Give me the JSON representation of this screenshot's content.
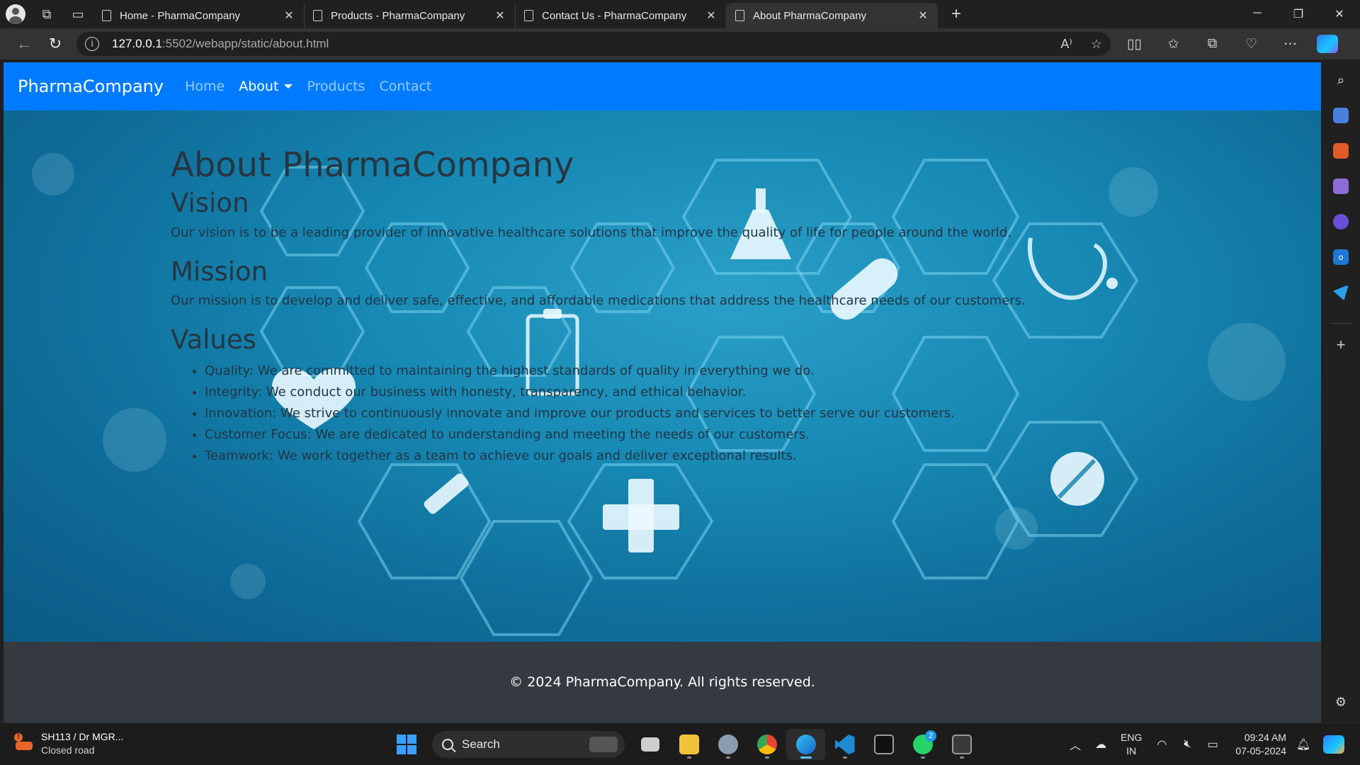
{
  "browser": {
    "tabs": [
      {
        "title": "Home - PharmaCompany",
        "active": false
      },
      {
        "title": "Products - PharmaCompany",
        "active": false
      },
      {
        "title": "Contact Us - PharmaCompany",
        "active": false
      },
      {
        "title": "About PharmaCompany",
        "active": true
      }
    ],
    "url_host": "127.0.0.1",
    "url_path": ":5502/webapp/static/about.html"
  },
  "site": {
    "brand": "PharmaCompany",
    "nav": {
      "home": "Home",
      "about": "About",
      "products": "Products",
      "contact": "Contact"
    },
    "heading": "About PharmaCompany",
    "vision_title": "Vision",
    "vision_text": "Our vision is to be a leading provider of innovative healthcare solutions that improve the quality of life for people around the world.",
    "mission_title": "Mission",
    "mission_text": "Our mission is to develop and deliver safe, effective, and affordable medications that address the healthcare needs of our customers.",
    "values_title": "Values",
    "values": [
      "Quality: We are committed to maintaining the highest standards of quality in everything we do.",
      "Integrity: We conduct our business with honesty, transparency, and ethical behavior.",
      "Innovation: We strive to continuously innovate and improve our products and services to better serve our customers.",
      "Customer Focus: We are dedicated to understanding and meeting the needs of our customers.",
      "Teamwork: We work together as a team to achieve our goals and deliver exceptional results."
    ],
    "footer": "© 2024 PharmaCompany. All rights reserved."
  },
  "taskbar": {
    "weather_title": "SH113 / Dr MGR...",
    "weather_sub": "Closed road",
    "search_label": "Search",
    "whatsapp_badge": "2",
    "lang_line1": "ENG",
    "lang_line2": "IN",
    "time": "09:24 AM",
    "date": "07-05-2024"
  },
  "colors": {
    "navbar": "#007bff",
    "footer": "#343a40",
    "hero_dark": "#0b5a86",
    "hero_light": "#2aa0c8"
  }
}
